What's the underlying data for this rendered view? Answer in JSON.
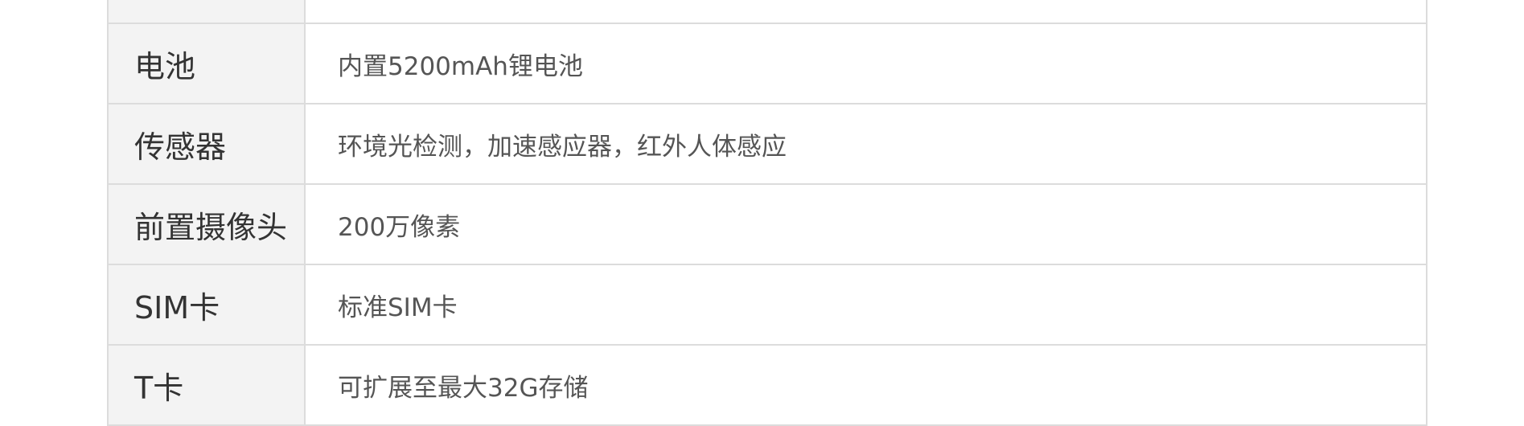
{
  "spec_table": {
    "rows": [
      {
        "label": "",
        "value": ""
      },
      {
        "label": "电池",
        "value": "内置5200mAh锂电池"
      },
      {
        "label": "传感器",
        "value": "环境光检测，加速感应器，红外人体感应"
      },
      {
        "label": "前置摄像头",
        "value": "200万像素"
      },
      {
        "label": "SIM卡",
        "value": "标准SIM卡"
      },
      {
        "label": "T卡",
        "value": "可扩展至最大32G存储"
      }
    ]
  }
}
